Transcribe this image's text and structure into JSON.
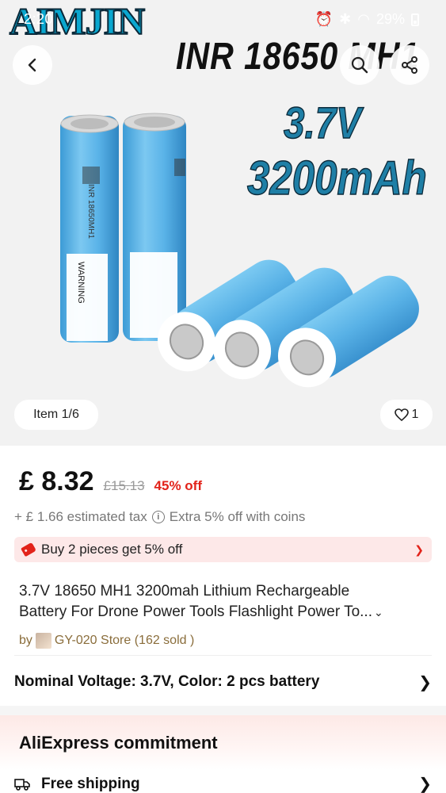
{
  "status_bar": {
    "time": "2:20",
    "battery": "29%"
  },
  "hero": {
    "brand": "AIMJIN",
    "model": "INR 18650 MH1",
    "voltage": "3.7V",
    "capacity": "3200mAh",
    "battery_label_1": "INR 18650MH1",
    "battery_label_2": "WARNING",
    "item_counter": "Item 1/6",
    "like_count": "1"
  },
  "price": {
    "current": "£ 8.32",
    "original": "£15.13",
    "discount": "45% off",
    "tax": "+ £ 1.66 estimated tax",
    "coins": "Extra 5% off with coins"
  },
  "promo": {
    "text": "Buy 2 pieces get 5% off"
  },
  "product": {
    "title_line1": "3.7V 18650 MH1 3200mah Lithium Rechargeable",
    "title_line2": "Battery For Drone Power Tools Flashlight Power To..."
  },
  "store": {
    "by": "by",
    "name": "GY-020 Store (162 sold )"
  },
  "variant": {
    "text": "Nominal Voltage: 3.7V, Color: 2 pcs battery"
  },
  "commitment": {
    "title": "AliExpress commitment",
    "shipping": "Free shipping"
  },
  "colors": {
    "accent": "#e2231a",
    "battery_blue": "#5bb6e8",
    "promo_bg": "#fde8e8"
  }
}
